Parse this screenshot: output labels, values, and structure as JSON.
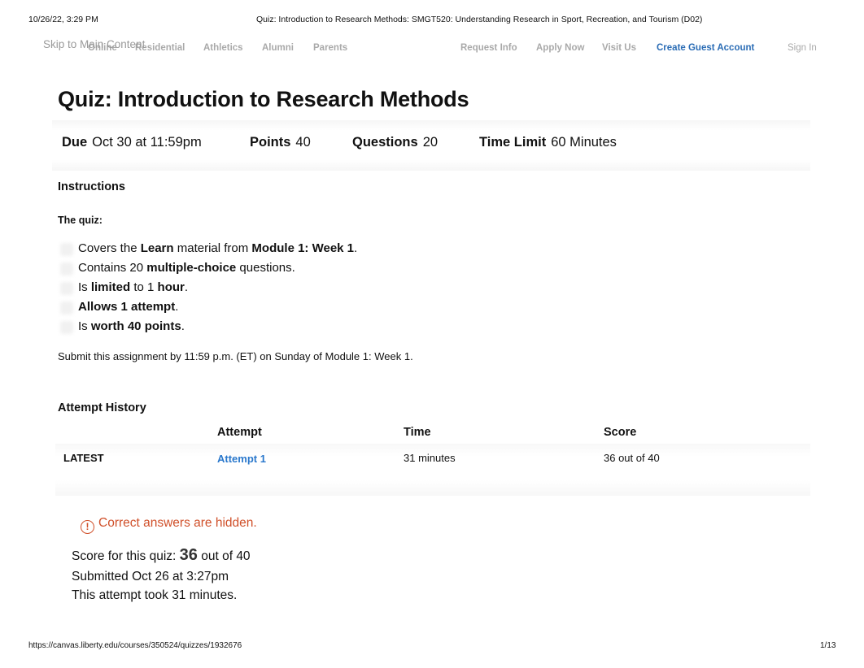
{
  "print_header": {
    "datetime": "10/26/22, 3:29 PM",
    "doc_title": "Quiz: Introduction to Research Methods: SMGT520: Understanding Research in Sport, Recreation, and Tourism (D02)"
  },
  "print_footer": {
    "url": "https://canvas.liberty.edu/courses/350524/quizzes/1932676",
    "page": "1/13"
  },
  "site_nav": {
    "skip_link": "Skip to Main Content",
    "left_items": [
      "Online",
      "Residential",
      "Athletics",
      "Alumni",
      "Parents"
    ],
    "right_items": [
      "Request Info",
      "Apply Now",
      "Visit Us",
      "Create Guest Account"
    ],
    "sign_in": "Sign In",
    "accent_color": "#2a6cb5"
  },
  "quiz": {
    "title": "Quiz: Introduction to Research Methods",
    "details": {
      "due_label": "Due",
      "due_value": "Oct 30 at 11:59pm",
      "points_label": "Points",
      "points_value": "40",
      "questions_label": "Questions",
      "questions_value": "20",
      "time_limit_label": "Time Limit",
      "time_limit_value": "60 Minutes"
    },
    "instructions_heading": "Instructions",
    "intro": "The quiz:",
    "bullets": [
      [
        {
          "t": "Covers the "
        },
        {
          "b": "Learn"
        },
        {
          "t": " material from "
        },
        {
          "b": "Module 1: Week 1"
        },
        {
          "t": "."
        }
      ],
      [
        {
          "t": "Contains 20 "
        },
        {
          "b": "multiple-choice"
        },
        {
          "t": " questions."
        }
      ],
      [
        {
          "t": "Is "
        },
        {
          "b": "limited"
        },
        {
          "t": " to 1 "
        },
        {
          "b": "hour"
        },
        {
          "t": "."
        }
      ],
      [
        {
          "b": "Allows 1 attempt"
        },
        {
          "t": "."
        }
      ],
      [
        {
          "t": "Is "
        },
        {
          "b": "worth 40 points"
        },
        {
          "t": "."
        }
      ]
    ],
    "submit_note": "Submit this assignment by 11:59 p.m. (ET) on Sunday of Module 1: Week 1."
  },
  "attempt_history": {
    "heading": "Attempt History",
    "columns": [
      "Attempt",
      "Time",
      "Score"
    ],
    "rows": [
      {
        "tag": "LATEST",
        "attempt": "Attempt 1",
        "time": "31 minutes",
        "score": "36 out of 40"
      }
    ],
    "link_color": "#2a78cc"
  },
  "result": {
    "hidden_note": "Correct answers are hidden.",
    "warning_color": "#d0502a",
    "score_prefix": "Score for this quiz: ",
    "score_value": "36",
    "score_suffix": " out of 40",
    "submitted": "Submitted Oct 26 at 3:27pm",
    "duration": "This attempt took 31 minutes."
  }
}
